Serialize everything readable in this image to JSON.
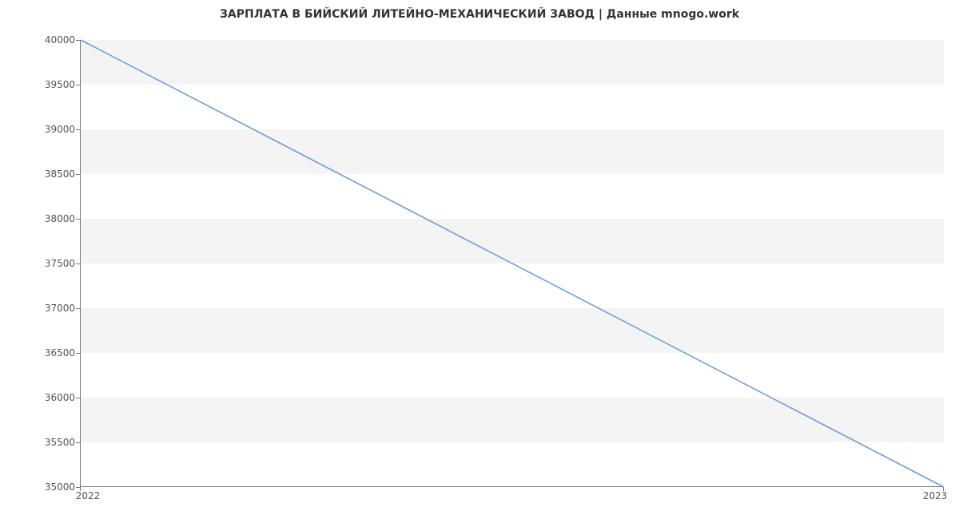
{
  "chart_data": {
    "type": "line",
    "title": "ЗАРПЛАТА В  БИЙСКИЙ ЛИТЕЙНО-МЕХАНИЧЕСКИЙ ЗАВОД | Данные mnogo.work",
    "x": [
      2022,
      2023
    ],
    "values": [
      40000,
      35000
    ],
    "xlabel": "",
    "ylabel": "",
    "xlim": [
      2022,
      2023
    ],
    "ylim": [
      35000,
      40000
    ],
    "xticks": [
      2022,
      2023
    ],
    "yticks": [
      35000,
      35500,
      36000,
      36500,
      37000,
      37500,
      38000,
      38500,
      39000,
      39500,
      40000
    ],
    "line_color": "#6f9fd8"
  }
}
